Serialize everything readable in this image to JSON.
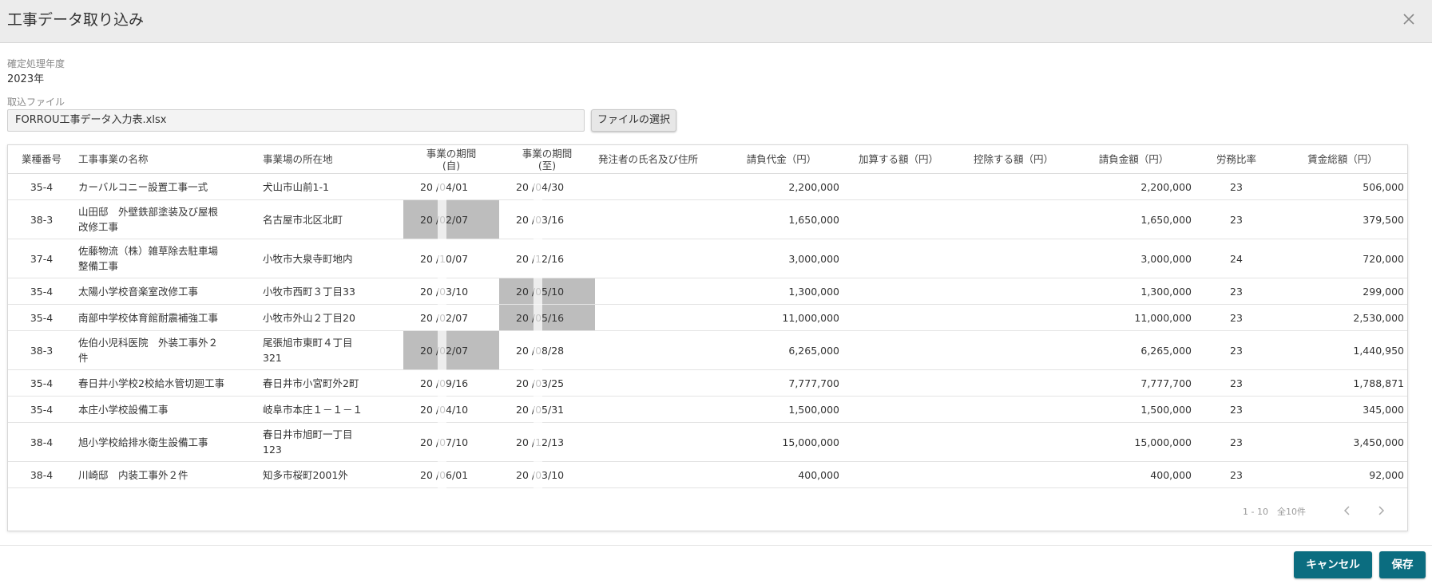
{
  "dialog": {
    "title": "工事データ取り込み"
  },
  "fiscal_year": {
    "label": "確定処理年度",
    "value": "2023年"
  },
  "import_file": {
    "label": "取込ファイル",
    "value": "FORROU工事データ入力表.xlsx",
    "select_button": "ファイルの選択"
  },
  "table": {
    "headers": {
      "industry_code": "業種番号",
      "project_name": "工事事業の名称",
      "location": "事業場の所在地",
      "period_start": [
        "事業の期間",
        "(自)"
      ],
      "period_end": [
        "事業の期間",
        "(至)"
      ],
      "client": "発注者の氏名及び住所",
      "contract_price": "請負代金（円）",
      "add_amount": "加算する額（円）",
      "deduct_amount": "控除する額（円）",
      "contract_amount": "請負金額（円）",
      "labor_ratio": "労務比率",
      "total_wages": "賃金総額（円）"
    },
    "rows": [
      {
        "code": "35-4",
        "name": [
          "カーバルコニー設置工事一式"
        ],
        "location": [
          "犬山市山前1-1"
        ],
        "start": "20  /04/01",
        "end": "20  /04/30",
        "client": "",
        "price": "2,200,000",
        "add": "",
        "deduct": "",
        "amount": "2,200,000",
        "ratio": "23",
        "wages": "506,000"
      },
      {
        "code": "38-3",
        "name": [
          "山田邸　外壁鉄部塗装及び屋根",
          "改修工事"
        ],
        "location": [
          "名古屋市北区北町"
        ],
        "start": "20  /02/07",
        "end": "20  /03/16",
        "client": "",
        "price": "1,650,000",
        "add": "",
        "deduct": "",
        "amount": "1,650,000",
        "ratio": "23",
        "wages": "379,500"
      },
      {
        "code": "37-4",
        "name": [
          "佐藤物流（株）雑草除去駐車場",
          "整備工事"
        ],
        "location": [
          "小牧市大泉寺町地内"
        ],
        "start": "20  /10/07",
        "end": "20  /12/16",
        "client": "",
        "price": "3,000,000",
        "add": "",
        "deduct": "",
        "amount": "3,000,000",
        "ratio": "24",
        "wages": "720,000"
      },
      {
        "code": "35-4",
        "name": [
          "太陽小学校音楽室改修工事"
        ],
        "location": [
          "小牧市西町３丁目33"
        ],
        "start": "20  /03/10",
        "end": "20  /05/10",
        "client": "",
        "price": "1,300,000",
        "add": "",
        "deduct": "",
        "amount": "1,300,000",
        "ratio": "23",
        "wages": "299,000"
      },
      {
        "code": "35-4",
        "name": [
          "南部中学校体育館耐震補強工事"
        ],
        "location": [
          "小牧市外山２丁目20"
        ],
        "start": "20  /02/07",
        "end": "20  /05/16",
        "client": "",
        "price": "11,000,000",
        "add": "",
        "deduct": "",
        "amount": "11,000,000",
        "ratio": "23",
        "wages": "2,530,000"
      },
      {
        "code": "38-3",
        "name": [
          "佐伯小児科医院　外装工事外２",
          "件"
        ],
        "location": [
          "尾張旭市東町４丁目",
          "321"
        ],
        "start": "20  /02/07",
        "end": "20  /08/28",
        "client": "",
        "price": "6,265,000",
        "add": "",
        "deduct": "",
        "amount": "6,265,000",
        "ratio": "23",
        "wages": "1,440,950"
      },
      {
        "code": "35-4",
        "name": [
          "春日井小学校2校給水管切廻工事"
        ],
        "location": [
          "春日井市小宮町外2町"
        ],
        "start": "20  /09/16",
        "end": "20  /03/25",
        "client": "",
        "price": "7,777,700",
        "add": "",
        "deduct": "",
        "amount": "7,777,700",
        "ratio": "23",
        "wages": "1,788,871"
      },
      {
        "code": "35-4",
        "name": [
          "本庄小学校設備工事"
        ],
        "location": [
          "岐阜市本庄１－１－１"
        ],
        "start": "20  /04/10",
        "end": "20  /05/31",
        "client": "",
        "price": "1,500,000",
        "add": "",
        "deduct": "",
        "amount": "1,500,000",
        "ratio": "23",
        "wages": "345,000"
      },
      {
        "code": "38-4",
        "name": [
          "旭小学校給排水衛生設備工事"
        ],
        "location": [
          "春日井市旭町一丁目",
          "123"
        ],
        "start": "20  /07/10",
        "end": "20  /12/13",
        "client": "",
        "price": "15,000,000",
        "add": "",
        "deduct": "",
        "amount": "15,000,000",
        "ratio": "23",
        "wages": "3,450,000"
      },
      {
        "code": "38-4",
        "name": [
          "川崎邸　内装工事外２件"
        ],
        "location": [
          "知多市桜町2001外"
        ],
        "start": "20  /06/01",
        "end": "20  /03/10",
        "client": "",
        "price": "400,000",
        "add": "",
        "deduct": "",
        "amount": "400,000",
        "ratio": "23",
        "wages": "92,000"
      }
    ],
    "highlighted_start_rows": [
      1,
      5
    ],
    "highlighted_end_rows": [
      3,
      4
    ],
    "highlight_color": "#bdbdbd"
  },
  "pagination": {
    "text": "1 - 10　全10件",
    "prev_icon": "chevron-left-icon",
    "next_icon": "chevron-right-icon"
  },
  "footer": {
    "cancel_label": "キャンセル",
    "save_label": "保存"
  },
  "colors": {
    "header_bg": "#ececec",
    "primary": "#0b6d80"
  }
}
